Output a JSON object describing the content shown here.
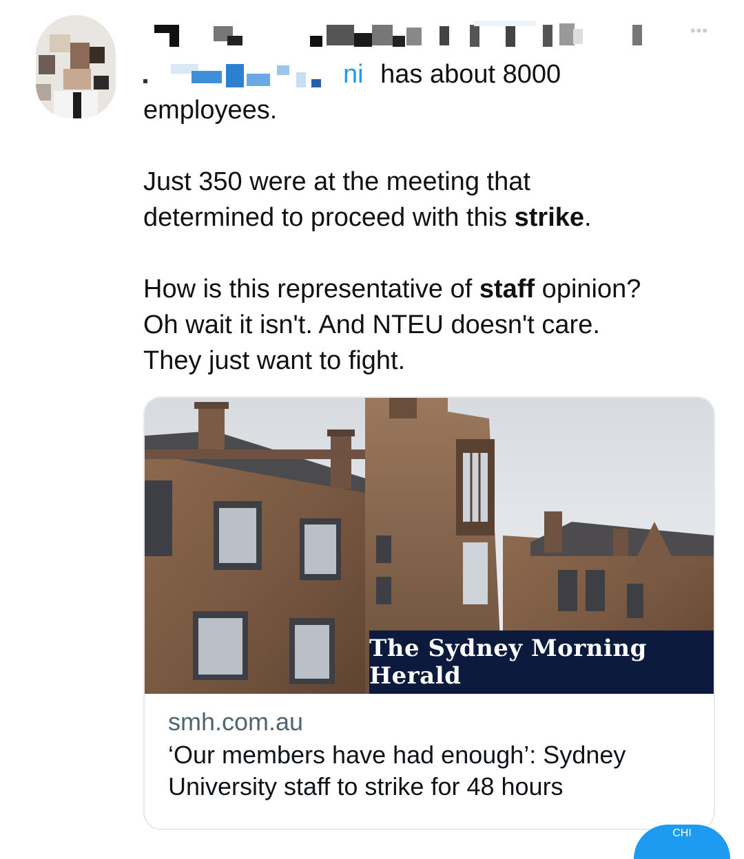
{
  "tweet": {
    "name_fragment": "ni",
    "line1_rest": "has about 8000",
    "line2": "employees.",
    "para2_line1": "Just 350 were at the meeting that",
    "para2_line2_pre": "determined to proceed with this ",
    "para2_bold": "strike",
    "para2_line2_post": ".",
    "para3_line1_pre": "How is this representative of ",
    "para3_bold": "staff",
    "para3_line1_post": " opinion?",
    "para3_line2": "Oh wait it isn't. And NTEU doesn't care.",
    "para3_line3": "They just want to fight."
  },
  "more_icon": "more-horizontal-icon",
  "link_card": {
    "masthead": "The Sydney Morning Herald",
    "domain": "smh.com.au",
    "title_line1": "‘Our members have had enough’: Sydney",
    "title_line2": "University staff to strike for 48 hours"
  },
  "corner_badge": "CHI",
  "colors": {
    "masthead_bg": "#0c1a3e",
    "card_border": "#e6e9ec",
    "secondary_text": "#536471",
    "accent": "#1d9bf0"
  }
}
